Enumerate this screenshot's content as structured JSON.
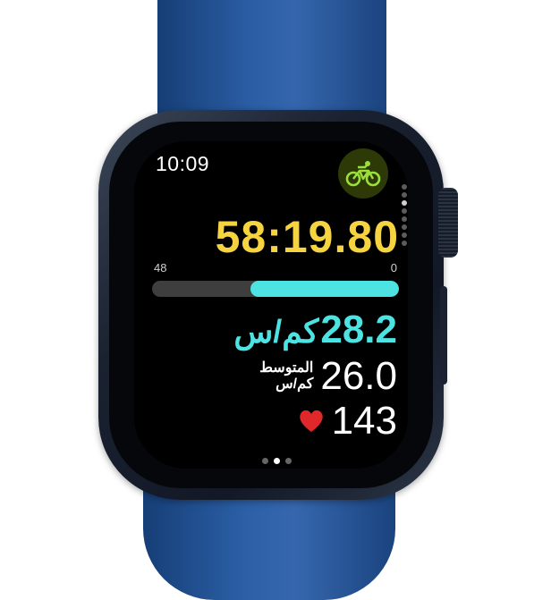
{
  "status": {
    "time": "10:09"
  },
  "workout": {
    "type_icon": "bicycle-icon",
    "accent_color": "#9be03a",
    "elapsed": "58:19.80",
    "range_max": "48",
    "range_min": "0",
    "speed_fraction": 0.6,
    "speed_value": "28.2",
    "speed_unit": "كم/س",
    "avg_label": "المتوسط",
    "avg_unit": "كم/س",
    "avg_value": "26.0",
    "heart_rate": "143",
    "heart_icon": "heart-icon"
  },
  "pager": {
    "page_count": 3,
    "active_page": 2
  },
  "colors": {
    "time": "#f5d440",
    "speed": "#4de3e3",
    "heart": "#e0272a",
    "band": "#2a5da3"
  }
}
